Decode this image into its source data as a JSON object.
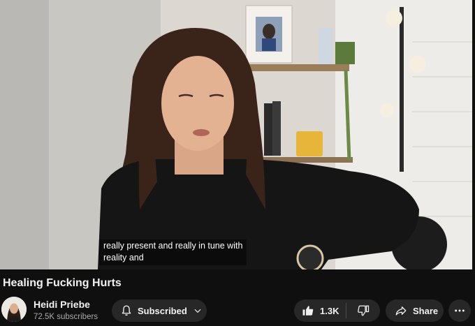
{
  "video": {
    "captions": [
      "really present and really in tune with",
      "reality and"
    ]
  },
  "title": "Healing Fucking Hurts",
  "channel": {
    "name": "Heidi Priebe",
    "subscribers": "72.5K subscribers"
  },
  "actions": {
    "subscribe_label": "Subscribed",
    "like_count": "1.3K",
    "share_label": "Share"
  },
  "icons": {
    "bell": "bell-icon",
    "chevron": "chevron-down-icon",
    "like": "thumbs-up-icon",
    "dislike": "thumbs-down-icon",
    "share": "share-icon",
    "more": "more-icon"
  },
  "colors": {
    "background": "#0f0f0f",
    "button": "#272727",
    "text": "#f1f1f1",
    "secondary_text": "#aaaaaa"
  }
}
